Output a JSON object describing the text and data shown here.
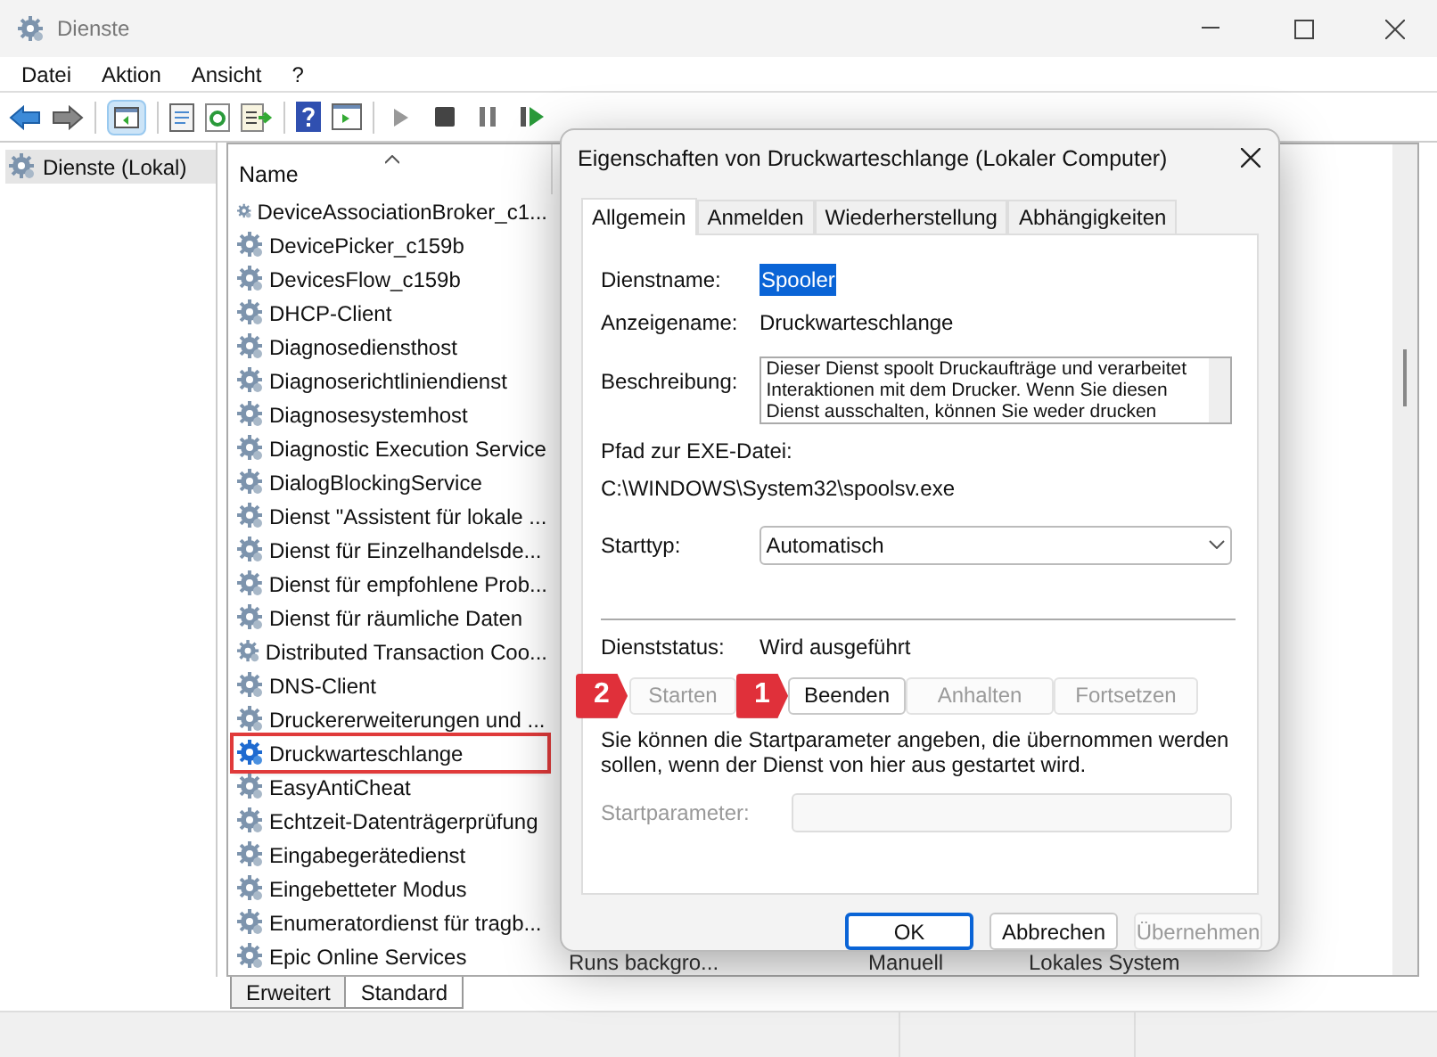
{
  "window": {
    "title": "Dienste"
  },
  "menu": [
    "Datei",
    "Aktion",
    "Ansicht",
    "?"
  ],
  "tree": {
    "items": [
      {
        "label": "Dienste (Lokal)",
        "selected": true
      }
    ]
  },
  "list": {
    "column": "Name",
    "rows": [
      {
        "name": "DeviceAssociationBroker_c1...",
        "highlighted": false
      },
      {
        "name": "DevicePicker_c159b",
        "highlighted": false
      },
      {
        "name": "DevicesFlow_c159b",
        "highlighted": false
      },
      {
        "name": "DHCP-Client",
        "highlighted": false
      },
      {
        "name": "Diagnosediensthost",
        "highlighted": false
      },
      {
        "name": "Diagnoserichtliniendienst",
        "highlighted": false
      },
      {
        "name": "Diagnosesystemhost",
        "highlighted": false
      },
      {
        "name": "Diagnostic Execution Service",
        "highlighted": false
      },
      {
        "name": "DialogBlockingService",
        "highlighted": false
      },
      {
        "name": "Dienst \"Assistent für lokale ...",
        "highlighted": false
      },
      {
        "name": "Dienst für Einzelhandelsde...",
        "highlighted": false
      },
      {
        "name": "Dienst für empfohlene Prob...",
        "highlighted": false
      },
      {
        "name": "Dienst für räumliche Daten",
        "highlighted": false
      },
      {
        "name": "Distributed Transaction Coo...",
        "highlighted": false
      },
      {
        "name": "DNS-Client",
        "highlighted": false
      },
      {
        "name": "Druckererweiterungen und ...",
        "highlighted": false
      },
      {
        "name": "Druckwarteschlange",
        "highlighted": true
      },
      {
        "name": "EasyAntiCheat",
        "highlighted": false
      },
      {
        "name": "Echtzeit-Datenträgerprüfung",
        "highlighted": false
      },
      {
        "name": "Eingabegerätedienst",
        "highlighted": false
      },
      {
        "name": "Eingebetteter Modus",
        "highlighted": false
      },
      {
        "name": "Enumeratordienst für tragb...",
        "highlighted": false
      },
      {
        "name": "Epic Online Services",
        "highlighted": false,
        "cells": [
          "Runs backgro...",
          "Manuell",
          "Lokales System"
        ]
      }
    ]
  },
  "view_tabs": [
    {
      "label": "Erweitert",
      "selected": false
    },
    {
      "label": "Standard",
      "selected": true
    }
  ],
  "dialog": {
    "title": "Eigenschaften von Druckwarteschlange (Lokaler Computer)",
    "tabs": [
      {
        "label": "Allgemein",
        "selected": true
      },
      {
        "label": "Anmelden",
        "selected": false
      },
      {
        "label": "Wiederherstellung",
        "selected": false
      },
      {
        "label": "Abhängigkeiten",
        "selected": false
      }
    ],
    "service_name_label": "Dienstname:",
    "service_name": "Spooler",
    "display_name_label": "Anzeigename:",
    "display_name": "Druckwarteschlange",
    "description_label": "Beschreibung:",
    "description": "Dieser Dienst spoolt Druckaufträge und verarbeitet Interaktionen mit dem Drucker. Wenn Sie diesen Dienst ausschalten, können Sie weder drucken",
    "path_label": "Pfad zur EXE-Datei:",
    "path": "C:\\WINDOWS\\System32\\spoolsv.exe",
    "startup_label": "Starttyp:",
    "startup_type": "Automatisch",
    "status_label": "Dienststatus:",
    "status": "Wird ausgeführt",
    "control_buttons": [
      {
        "label": "Starten",
        "disabled": true,
        "callout": "2"
      },
      {
        "label": "Beenden",
        "disabled": false,
        "callout": "1"
      },
      {
        "label": "Anhalten",
        "disabled": true
      },
      {
        "label": "Fortsetzen",
        "disabled": true
      }
    ],
    "hint": "Sie können die Startparameter angeben, die übernommen werden sollen, wenn der Dienst von hier aus gestartet wird.",
    "param_label": "Startparameter:",
    "param_disabled": true,
    "buttons": [
      {
        "label": "OK",
        "default": true,
        "disabled": false
      },
      {
        "label": "Abbrechen",
        "default": false,
        "disabled": false
      },
      {
        "label": "Übernehmen",
        "default": false,
        "disabled": true
      }
    ]
  }
}
